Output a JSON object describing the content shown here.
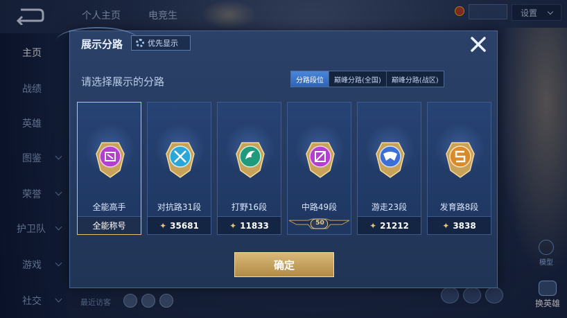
{
  "background": {
    "left_nav": [
      {
        "label": "主页",
        "active": true,
        "chevron": false
      },
      {
        "label": "战绩",
        "active": false,
        "chevron": false
      },
      {
        "label": "英雄",
        "active": false,
        "chevron": false
      },
      {
        "label": "图鉴",
        "active": false,
        "chevron": true
      },
      {
        "label": "荣誉",
        "active": false,
        "chevron": true
      },
      {
        "label": "护卫队",
        "active": false,
        "chevron": true
      },
      {
        "label": "游戏",
        "active": false,
        "chevron": true
      },
      {
        "label": "社交",
        "active": false,
        "chevron": true
      }
    ],
    "top_tabs": [
      "个人主页",
      "电竞生"
    ],
    "settings_label": "设置",
    "model_label": "模型",
    "switch_hero_label": "换英雄",
    "recent_visitors": "最近访客"
  },
  "modal": {
    "title": "展示分路",
    "priority_label": "优先显示",
    "subtitle": "请选择展示的分路",
    "segment_tabs": [
      {
        "label": "分路段位",
        "active": true
      },
      {
        "label": "巅峰分路(全国)",
        "active": false
      },
      {
        "label": "巅峰分路(战区)",
        "active": false
      }
    ],
    "cards": [
      {
        "name": "全能高手",
        "footer": "全能称号",
        "selected": true,
        "icon": "all-rounder-medal-icon",
        "color": "#b13fd0"
      },
      {
        "name": "对抗路31段",
        "score": "35681",
        "selected": false,
        "icon": "clash-lane-medal-icon",
        "color": "#2aa6d8"
      },
      {
        "name": "打野16段",
        "score": "11833",
        "selected": false,
        "icon": "jungle-medal-icon",
        "color": "#1f9a7a"
      },
      {
        "name": "中路49段",
        "level": "50",
        "selected": false,
        "icon": "mid-lane-medal-icon",
        "color": "#b13fd0"
      },
      {
        "name": "游走23段",
        "score": "21212",
        "selected": false,
        "icon": "roam-medal-icon",
        "color": "#3b6fd6"
      },
      {
        "name": "发育路8段",
        "score": "3838",
        "selected": false,
        "icon": "farm-lane-medal-icon",
        "color": "#d98a2b"
      }
    ],
    "confirm_label": "确定"
  },
  "colors": {
    "accent_gold": "#e2c178",
    "active_tab": "#3d78cc",
    "modal_bg": "#26395f"
  }
}
